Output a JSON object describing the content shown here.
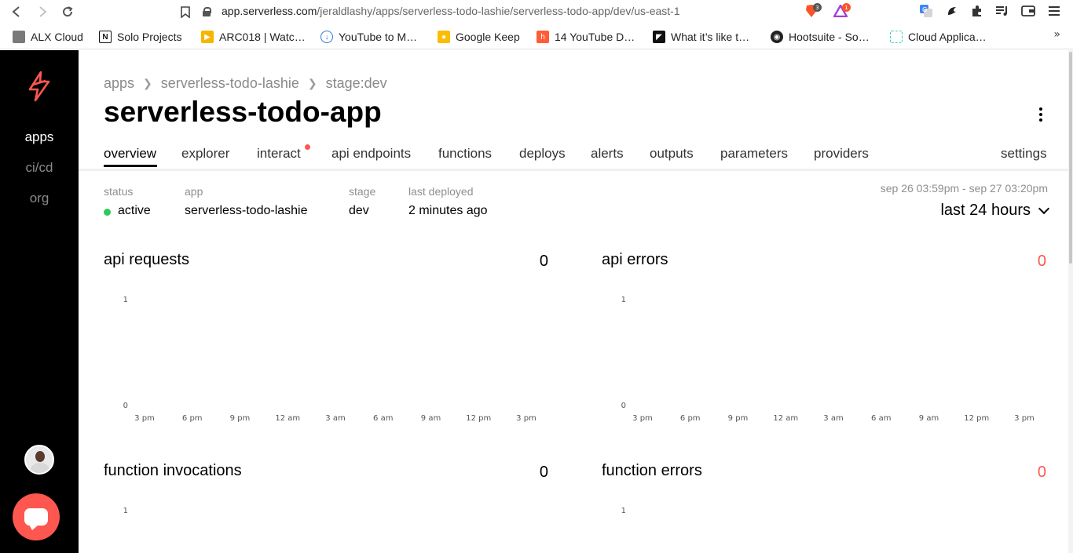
{
  "browser": {
    "url_domain": "app.serverless.com",
    "url_path": "/jeraldlashy/apps/serverless-todo-lashie/serverless-todo-app/dev/us-east-1",
    "brave_badge": "3",
    "rewards_badge": "1",
    "bookmarks": [
      {
        "label": "ALX Cloud",
        "icon": "folder-icon",
        "color": "#6b6b6b"
      },
      {
        "label": "Solo Projects",
        "icon": "notion-icon",
        "color": "#111111"
      },
      {
        "label": "ARC018 | Watc…",
        "icon": "arc-icon",
        "color": "#f7b500"
      },
      {
        "label": "YouTube to M…",
        "icon": "download-icon",
        "color": "#2f7ad1"
      },
      {
        "label": "Google Keep",
        "icon": "keep-icon",
        "color": "#fbbc04"
      },
      {
        "label": "14 YouTube D…",
        "icon": "hubspot-icon",
        "color": "#ff5c35"
      },
      {
        "label": "What it’s like t…",
        "icon": "medium-icon",
        "color": "#111111"
      },
      {
        "label": "Hootsuite - So…",
        "icon": "owl-icon",
        "color": "#222222"
      },
      {
        "label": "Cloud Applica…",
        "icon": "dashed-box-icon",
        "color": "#3ecfbe"
      }
    ],
    "more_label": "»"
  },
  "sidebar": {
    "items": [
      {
        "label": "apps",
        "active": true
      },
      {
        "label": "ci/cd",
        "active": false
      },
      {
        "label": "org",
        "active": false
      }
    ]
  },
  "breadcrumb": [
    "apps",
    "serverless-todo-lashie",
    "stage:dev"
  ],
  "title": "serverless-todo-app",
  "tabs": [
    {
      "label": "overview",
      "active": true
    },
    {
      "label": "explorer"
    },
    {
      "label": "interact",
      "dot": true
    },
    {
      "label": "api endpoints"
    },
    {
      "label": "functions"
    },
    {
      "label": "deploys"
    },
    {
      "label": "alerts"
    },
    {
      "label": "outputs"
    },
    {
      "label": "parameters"
    },
    {
      "label": "providers"
    },
    {
      "label": "settings"
    }
  ],
  "meta": {
    "status_label": "status",
    "status_value": "active",
    "app_label": "app",
    "app_value": "serverless-todo-lashie",
    "stage_label": "stage",
    "stage_value": "dev",
    "deployed_label": "last deployed",
    "deployed_value": "2 minutes ago"
  },
  "time": {
    "range": "sep 26 03:59pm - sep 27 03:20pm",
    "period": "last 24 hours"
  },
  "colors": {
    "accent": "#fd5750",
    "active_status": "#2fc95f"
  },
  "chart_data": [
    {
      "type": "line",
      "title": "api requests",
      "total": "0",
      "x": [
        "3 pm",
        "6 pm",
        "9 pm",
        "12 am",
        "3 am",
        "6 am",
        "9 am",
        "12 pm",
        "3 pm"
      ],
      "series": [],
      "ylim": [
        0,
        1
      ],
      "yticks": [
        "1",
        "0"
      ]
    },
    {
      "type": "line",
      "title": "api errors",
      "total": "0",
      "x": [
        "3 pm",
        "6 pm",
        "9 pm",
        "12 am",
        "3 am",
        "6 am",
        "9 am",
        "12 pm",
        "3 pm"
      ],
      "series": [],
      "ylim": [
        0,
        1
      ],
      "yticks": [
        "1",
        "0"
      ]
    },
    {
      "type": "line",
      "title": "function invocations",
      "total": "0",
      "x": [],
      "series": [],
      "ylim": [
        0,
        1
      ],
      "yticks": [
        "1"
      ]
    },
    {
      "type": "line",
      "title": "function errors",
      "total": "0",
      "x": [],
      "series": [],
      "ylim": [
        0,
        1
      ],
      "yticks": [
        "1"
      ]
    }
  ]
}
